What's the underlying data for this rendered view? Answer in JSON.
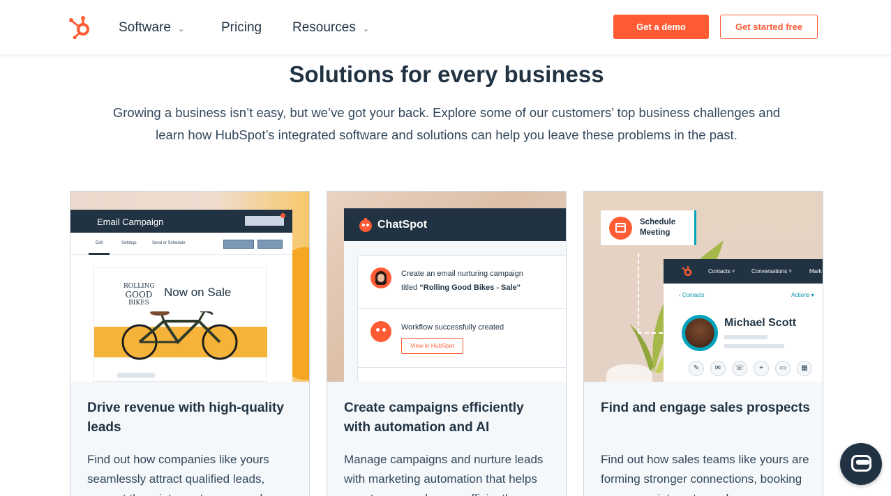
{
  "nav": {
    "items": [
      {
        "label": "Software",
        "has_dropdown": true
      },
      {
        "label": "Pricing",
        "has_dropdown": false
      },
      {
        "label": "Resources",
        "has_dropdown": true
      }
    ],
    "demo_label": "Get a demo",
    "free_label": "Get started free"
  },
  "header": {
    "title": "Solutions for every business",
    "intro": "Growing a business isn’t easy, but we’ve got your back. Explore some of our customers’ top business challenges and learn how HubSpot’s integrated software and solutions can help you leave these problems in the past."
  },
  "cards": [
    {
      "title": "Drive revenue with high-quality leads",
      "body": "Find out how companies like yours seamlessly attract qualified leads, convert them into customers, and",
      "media": {
        "window_title": "Email Campaign",
        "tabs": [
          "Edit",
          "Settings",
          "Send or Schedule"
        ],
        "logo_text": [
          "ROLLING",
          "GOOD",
          "BIKES"
        ],
        "headline": "Now on Sale"
      }
    },
    {
      "title": "Create campaigns efficiently with automation and AI",
      "body": "Manage campaigns and nurture leads with marketing automation that helps your teams work more efficiently as",
      "media": {
        "brand": "ChatSpot",
        "prompt_line1": "Create an email nurturing campaign",
        "prompt_line2_prefix": "titled ",
        "prompt_line2_bold": "“Rolling Good Bikes - Sale”",
        "result": "Workflow successfully created",
        "result_button": "View in HubSpot"
      }
    },
    {
      "title": "Find and engage sales prospects",
      "body": "Find out how sales teams like yours are forming stronger connections, booking more appointments, and",
      "media": {
        "schedule_line1": "Schedule",
        "schedule_line2": "Meeting",
        "crm_nav": [
          "Contacts",
          "Conversations",
          "Mark"
        ],
        "back_link": "Contacts",
        "actions": "Actions",
        "contact_name": "Michael Scott",
        "action_icons": [
          "edit-icon",
          "email-icon",
          "phone-icon",
          "plus-icon",
          "window-icon",
          "calendar-icon"
        ]
      }
    }
  ],
  "colors": {
    "accent": "#ff5c35",
    "navy": "#213343",
    "teal": "#00a4bd",
    "card_bg": "#f5f8fa"
  }
}
